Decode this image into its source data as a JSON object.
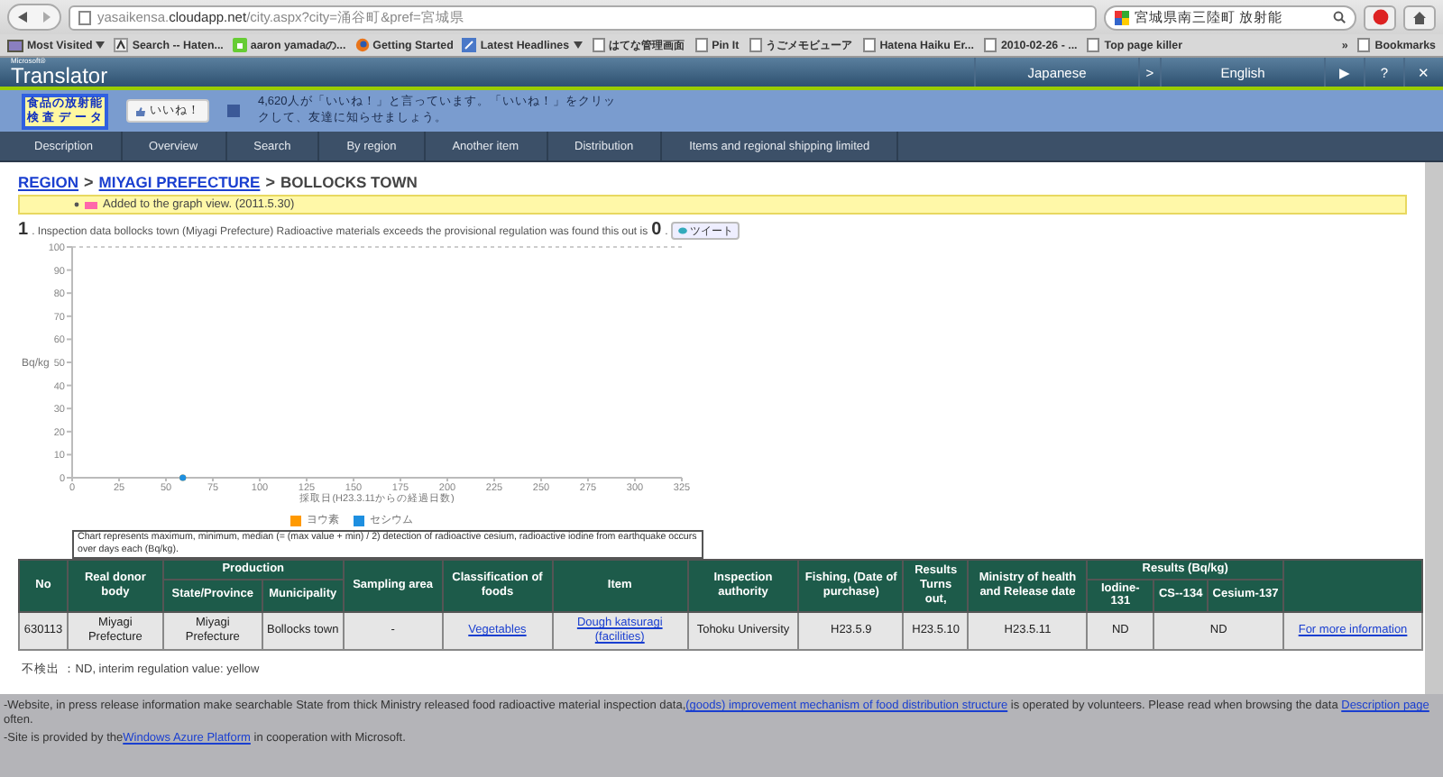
{
  "browser": {
    "url_host": "yasaikensa.",
    "url_domain": "cloudapp.net",
    "url_path": "/city.aspx?city=涌谷町&pref=宮城県",
    "search": "宮城県南三陸町 放射能",
    "bookmarks": [
      {
        "label": "Most Visited",
        "menu": true
      },
      {
        "label": "Search -- Haten...",
        "menu": false
      },
      {
        "label": "aaron yamadaの...",
        "menu": false
      },
      {
        "label": "Getting Started",
        "menu": false
      },
      {
        "label": "Latest Headlines",
        "menu": true
      },
      {
        "label": "はてな管理画面",
        "menu": false
      },
      {
        "label": "Pin It",
        "menu": false
      },
      {
        "label": "うごメモビューア",
        "menu": false
      },
      {
        "label": "Hatena Haiku Er...",
        "menu": false
      },
      {
        "label": "2010-02-26 - ...",
        "menu": false
      },
      {
        "label": "Top page killer",
        "menu": false
      }
    ],
    "bookmarks_overflow": "»",
    "bookmarks_menu": "Bookmarks"
  },
  "translator": {
    "brand_small": "Microsoft®",
    "brand": "Translator",
    "from": "Japanese",
    "arrow": ">",
    "to": "English",
    "play": "▶",
    "help": "?",
    "close": "✕"
  },
  "banner": {
    "logo_line1": "食品の放射能",
    "logo_line2": "検 査 デ ー タ",
    "like_button": "いいね！",
    "like_text": "4,620人が「いいね！」と言っています。「いいね！」をクリックして、友達に知らせましょう。"
  },
  "nav": [
    {
      "label": "Description"
    },
    {
      "label": "Overview"
    },
    {
      "label": "Search"
    },
    {
      "label": "By region"
    },
    {
      "label": "Another item"
    },
    {
      "label": "Distribution"
    },
    {
      "label": "Items and regional shipping limited"
    }
  ],
  "breadcrumb": [
    {
      "label": "REGION",
      "link": true
    },
    {
      "label": "MIYAGI PREFECTURE",
      "link": true
    },
    {
      "label": "BOLLOCKS TOWN",
      "link": false
    }
  ],
  "breadcrumb_sep": ">",
  "notice": {
    "text": "Added to the graph view. (2011.5.30)"
  },
  "heading": {
    "number": "1",
    "text": ". Inspection data bollocks town (Miyagi Prefecture) Radioactive materials exceeds the provisional regulation was found this out is",
    "count": "0",
    "suffix": ".",
    "tweet": "ツイート"
  },
  "chart_data": {
    "type": "scatter",
    "xlabel": "採取日(H23.3.11からの経過日数)",
    "ylabel": "Bq/kg",
    "x": [
      59
    ],
    "series": [
      {
        "name": "ヨウ素",
        "color": "#ff9900",
        "values": [
          0
        ]
      },
      {
        "name": "セシウム",
        "color": "#1e8fe0",
        "values": [
          0
        ]
      }
    ],
    "legend": true,
    "xlim": [
      0,
      325
    ],
    "ylim": [
      0,
      100
    ],
    "xticks": [
      0,
      25,
      50,
      75,
      100,
      125,
      150,
      175,
      200,
      225,
      250,
      275,
      300,
      325
    ],
    "yticks": [
      0,
      10,
      20,
      30,
      40,
      50,
      60,
      70,
      80,
      90,
      100
    ]
  },
  "chart_caption": "Chart represents maximum, minimum, median (= (max value + min) / 2) detection of radioactive cesium, radioactive iodine from earthquake occurs over days each (Bq/kg).",
  "table": {
    "columns": [
      {
        "kind": "single",
        "label": "No"
      },
      {
        "kind": "single",
        "label": "Real donor body"
      },
      {
        "kind": "group",
        "label": "Production",
        "colspan": 2,
        "children": [
          "State/Province",
          "Municipality"
        ]
      },
      {
        "kind": "single",
        "label": "Sampling area"
      },
      {
        "kind": "single",
        "label": "Classification of foods"
      },
      {
        "kind": "single",
        "label": "Item"
      },
      {
        "kind": "single",
        "label": "Inspection authority"
      },
      {
        "kind": "single",
        "label": "Fishing, (Date of purchase)"
      },
      {
        "kind": "single",
        "label": "Results Turns out,"
      },
      {
        "kind": "single",
        "label": "Ministry of health and Release date"
      },
      {
        "kind": "group",
        "label": "Results (Bq/kg)",
        "colspan": 3,
        "children": [
          "Iodine-131",
          "CS--134",
          "Cesium-137"
        ]
      },
      {
        "kind": "blank"
      }
    ],
    "rows": [
      [
        {
          "kind": "text",
          "text": "630113"
        },
        {
          "kind": "text",
          "text": "Miyagi Prefecture"
        },
        {
          "kind": "text",
          "text": "Miyagi Prefecture"
        },
        {
          "kind": "text",
          "text": "Bollocks town"
        },
        {
          "kind": "text",
          "text": "-"
        },
        {
          "kind": "link",
          "text": "Vegetables"
        },
        {
          "kind": "link",
          "text": "Dough katsuragi (facilities)"
        },
        {
          "kind": "text",
          "text": "Tohoku University"
        },
        {
          "kind": "text",
          "text": "H23.5.9"
        },
        {
          "kind": "text",
          "text": "H23.5.10"
        },
        {
          "kind": "text",
          "text": "H23.5.11"
        },
        {
          "kind": "text",
          "text": "ND"
        },
        {
          "kind": "text",
          "text": "ND",
          "colspan": 2
        },
        {
          "kind": "link",
          "text": "For more information"
        }
      ]
    ]
  },
  "legend_note": "不検出 ：ND, interim regulation value: yellow",
  "footer": [
    [
      {
        "text": "-Website, in press release information make searchable State from thick Ministry released food radioactive material inspection data,",
        "link": false
      },
      {
        "text": "(goods) improvement mechanism of food distribution structure",
        "link": true
      },
      {
        "text": " is operated by volunteers. Please read when browsing the data ",
        "link": false
      },
      {
        "text": "Description page",
        "link": true
      },
      {
        "text": " often.",
        "link": false
      }
    ],
    [
      {
        "text": "-Site is provided by the",
        "link": false
      },
      {
        "text": "Windows Azure Platform",
        "link": true
      },
      {
        "text": " in cooperation with Microsoft.",
        "link": false
      }
    ]
  ]
}
